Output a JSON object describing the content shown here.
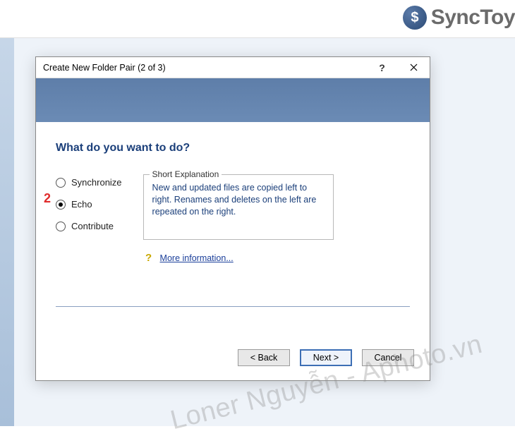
{
  "brand": {
    "name": "SyncToy"
  },
  "dialog": {
    "title": "Create New Folder Pair (2 of 3)",
    "heading": "What do you want to do?",
    "options": {
      "synchronize": "Synchronize",
      "echo": "Echo",
      "contribute": "Contribute",
      "selected": "echo"
    },
    "explanation": {
      "legend": "Short Explanation",
      "text": "New and updated files are copied left to right. Renames and deletes on the left are repeated on the right."
    },
    "more_info": "More information...",
    "buttons": {
      "back": "< Back",
      "next": "Next >",
      "cancel": "Cancel"
    }
  },
  "annotation": {
    "step_label": "2"
  },
  "watermark": "Loner Nguyễn - Aphoto.vn"
}
